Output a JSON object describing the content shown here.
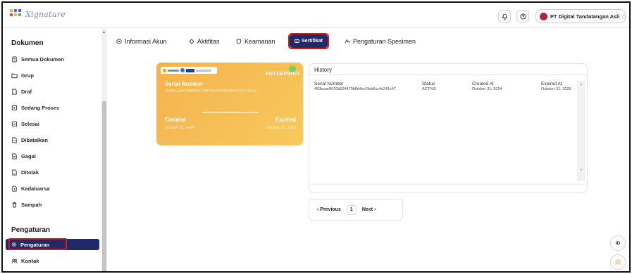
{
  "app": {
    "logo_text": "Xignature"
  },
  "topbar": {
    "org_name": "PT Digital Tandatangan Asli",
    "org_caret": "◇"
  },
  "sidebar": {
    "section_documents": "Dokumen",
    "documents": [
      {
        "label": "Semua Dokumen",
        "icon": "documents-icon"
      },
      {
        "label": "Grup",
        "icon": "folder-icon"
      },
      {
        "label": "Draf",
        "icon": "file-icon"
      },
      {
        "label": "Sedang Proses",
        "icon": "process-icon"
      },
      {
        "label": "Selesai",
        "icon": "done-icon"
      },
      {
        "label": "Dibatalkan",
        "icon": "cancel-doc-icon"
      },
      {
        "label": "Gagal",
        "icon": "failed-doc-icon"
      },
      {
        "label": "Ditolak",
        "icon": "rejected-doc-icon"
      },
      {
        "label": "Kadaluarsa",
        "icon": "expired-doc-icon"
      },
      {
        "label": "Sampah",
        "icon": "trash-icon"
      }
    ],
    "section_settings": "Pengaturan",
    "settings": [
      {
        "label": "Pengaturan",
        "icon": "gear-icon",
        "active": true
      },
      {
        "label": "Kontak",
        "icon": "contacts-icon"
      }
    ]
  },
  "tabs": [
    {
      "label": "Informasi Akun",
      "icon": "info-icon"
    },
    {
      "label": "Aktifitas",
      "icon": "activity-icon"
    },
    {
      "label": "Keamanan",
      "icon": "shield-icon"
    },
    {
      "label": "Sertifikat",
      "icon": "certificate-icon",
      "active": true
    },
    {
      "label": "Pengaturan Spesimen",
      "icon": "signature-icon"
    }
  ],
  "certificate": {
    "badge": "ENTERPRISE",
    "serial_label": "Serial Number",
    "serial_value": "450BCAE9010B524470BFFD4EC2FEB6CC4C241C47",
    "created_label": "Created",
    "created_value": "October 31, 2024",
    "expired_label": "Expired",
    "expired_value": "October 31, 2025"
  },
  "history": {
    "title": "History",
    "columns": [
      "Serial Number",
      "Status",
      "Created At",
      "Expired At"
    ],
    "rows": [
      [
        "450bcae9010b524470bffd4ec2feb6cc4c241c47",
        "ACTIVE",
        "October 31, 2024",
        "October 31, 2025"
      ]
    ]
  },
  "pagination": {
    "previous": "‹  Previous",
    "current": "1",
    "next": "Next  ›"
  },
  "floating": {
    "lang": "ID",
    "theme_icon": "sun-icon"
  },
  "colors": {
    "primary": "#202A66",
    "highlight": "#D01B1B",
    "card_gradient": "#F6B24C"
  }
}
